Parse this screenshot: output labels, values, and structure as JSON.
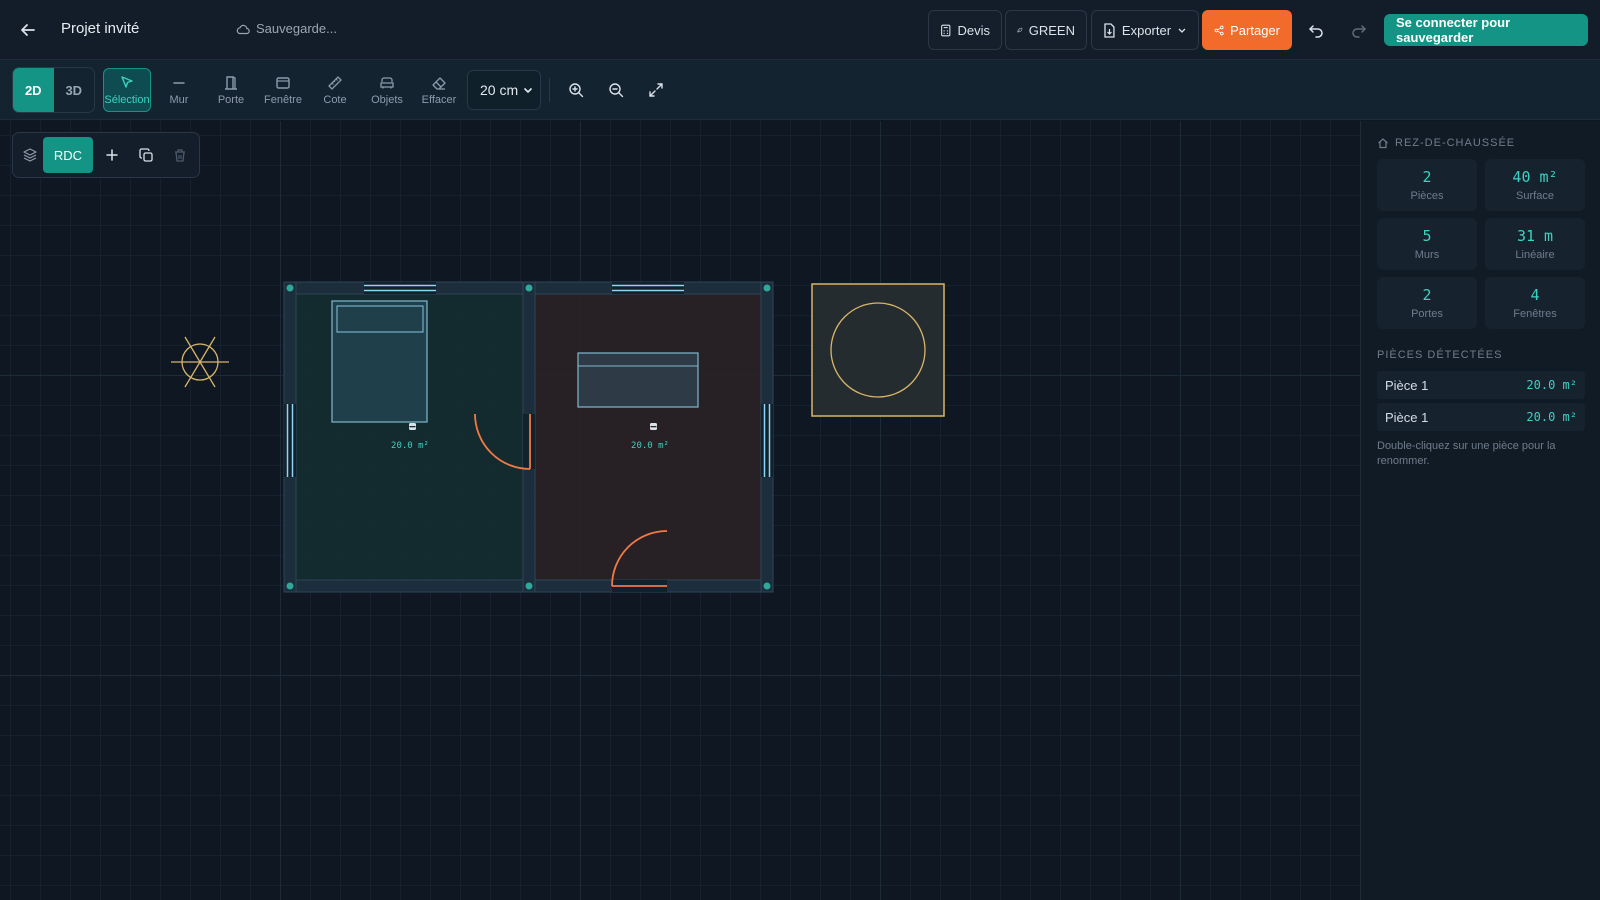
{
  "header": {
    "project_title": "Projet invité",
    "save_status": "Sauvegarde...",
    "devis_label": "Devis",
    "green_label": "GREEN",
    "export_label": "Exporter",
    "share_label": "Partager",
    "login_label": "Se connecter pour sauvegarder"
  },
  "toolbar": {
    "view_2d": "2D",
    "view_3d": "3D",
    "tools": [
      {
        "label": "Sélection",
        "icon": "cursor-icon",
        "active": true
      },
      {
        "label": "Mur",
        "icon": "wall-line-icon",
        "active": false
      },
      {
        "label": "Porte",
        "icon": "door-icon",
        "active": false
      },
      {
        "label": "Fenêtre",
        "icon": "window-icon",
        "active": false
      },
      {
        "label": "Cote",
        "icon": "ruler-icon",
        "active": false
      },
      {
        "label": "Objets",
        "icon": "sofa-icon",
        "active": false
      },
      {
        "label": "Effacer",
        "icon": "eraser-icon",
        "active": false
      }
    ],
    "grid_size": "20 cm"
  },
  "canvas": {
    "level_chip": "RDC",
    "rooms": [
      {
        "icon": "paint-bucket-icon",
        "area": "20.0 m²"
      },
      {
        "icon": "paint-bucket-icon",
        "area": "20.0 m²"
      }
    ]
  },
  "sidebar": {
    "level_title": "REZ-DE-CHAUSSÉE",
    "stats": [
      {
        "value": "2",
        "label": "Pièces"
      },
      {
        "value": "40 m²",
        "label": "Surface"
      },
      {
        "value": "5",
        "label": "Murs"
      },
      {
        "value": "31 m",
        "label": "Linéaire"
      },
      {
        "value": "2",
        "label": "Portes"
      },
      {
        "value": "4",
        "label": "Fenêtres"
      }
    ],
    "rooms_title": "PIÈCES DÉTECTÉES",
    "rooms": [
      {
        "name": "Pièce 1",
        "area": "20.0 m²"
      },
      {
        "name": "Pièce 1",
        "area": "20.0 m²"
      }
    ],
    "hint": "Double-cliquez sur une pièce pour la renommer."
  },
  "colors": {
    "accent": "#149485",
    "accent_text": "#3dd1bf",
    "share": "#f26b2a",
    "door": "#f07a45",
    "window": "#8fd3f4",
    "object_outline": "#d8b56a"
  }
}
